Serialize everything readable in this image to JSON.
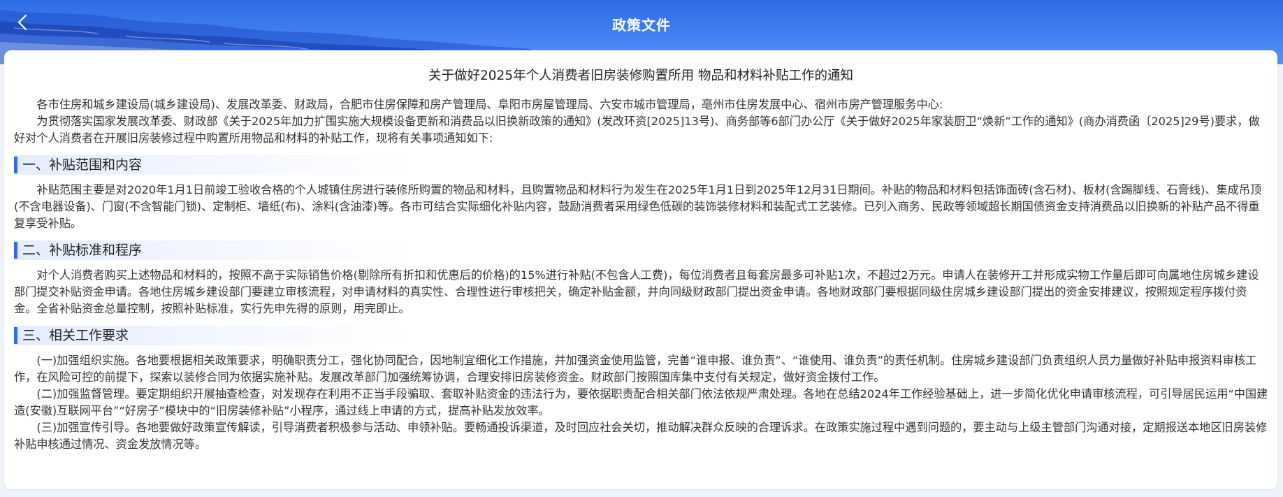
{
  "header": {
    "title": "政策文件",
    "back_icon": "chevron-left-icon",
    "colors": {
      "primary": "#2f6de6",
      "wave": "#1a3fb0"
    }
  },
  "document": {
    "title": "关于做好2025年个人消费者旧房装修购置所用 物品和材料补贴工作的通知",
    "addressee": "各市住房和城乡建设局(城乡建设局)、发展改革委、财政局，合肥市住房保障和房产管理局、阜阳市房屋管理局、六安市城市管理局，亳州市住房发展中心、宿州市房产管理服务中心:",
    "intro": "为贯彻落实国家发展改革委、财政部《关于2025年加力扩围实施大规模设备更新和消费品以旧换新政策的通知》(发改环资[2025]13号)、商务部等6部门办公厅《关于做好2025年家装厨卫“焕新”工作的通知》(商办消费函〔2025]29号)要求，做好对个人消费者在开展旧房装修过程中购置所用物品和材料的补贴工作，现将有关事项通知如下:",
    "sections": [
      {
        "heading": "一、补贴范围和内容",
        "paragraphs": [
          "补贴范围主要是对2020年1月1日前竣工验收合格的个人城镇住房进行装修所购置的物品和材料，且购置物品和材料行为发生在2025年1月1日到2025年12月31日期间。补贴的物品和材料包括饰面砖(含石材)、板材(含踢脚线、石膏线)、集成吊顶(不含电器设备)、门窗(不含智能门锁)、定制柜、墙纸(布)、涂料(含油漆)等。各市可结合实际细化补贴内容，鼓励消费者采用绿色低碳的装饰装修材料和装配式工艺装修。已列入商务、民政等领域超长期国债资金支持消费品以旧换新的补贴产品不得重复享受补贴。"
        ]
      },
      {
        "heading": "二、补贴标准和程序",
        "paragraphs": [
          "对个人消费者购买上述物品和材料的，按照不高于实际销售价格(剔除所有折扣和优惠后的价格)的15%进行补贴(不包含人工费)，每位消费者且每套房最多可补贴1次，不超过2万元。申请人在装修开工并形成实物工作量后即可向属地住房城乡建设部门提交补贴资金申请。各地住房城乡建设部门要建立审核流程，对申请材料的真实性、合理性进行审核把关，确定补贴金额，并向同级财政部门提出资金申请。各地财政部门要根据同级住房城乡建设部门提出的资金安排建议，按照规定程序拨付资金。全省补贴资金总量控制，按照补贴标准，实行先申先得的原则，用完即止。"
        ]
      },
      {
        "heading": "三、相关工作要求",
        "paragraphs": [
          "(一)加强组织实施。各地要根据相关政策要求，明确职责分工，强化协同配合，因地制宜细化工作措施，并加强资金使用监管，完善“谁申报、谁负责”、“谁使用、谁负责”的责任机制。住房城乡建设部门负责组织人员力量做好补贴申报资料审核工作，在风险可控的前提下，探索以装修合同为依据实施补贴。发展改革部门加强统筹协调，合理安排旧房装修资金。财政部门按照国库集中支付有关规定，做好资金拨付工作。",
          "(二)加强监督管理。要定期组织开展抽查检查，对发现存在利用不正当手段骗取、套取补贴资金的违法行为，要依据职责配合相关部门依法依规严肃处理。各地在总结2024年工作经验基础上，进一步简化优化申请审核流程，可引导居民运用“中国建造(安徽)互联网平台”“好房子”模块中的“旧房装修补贴”小程序，通过线上申请的方式，提高补贴发放效率。",
          "(三)加强宣传引导。各地要做好政策宣传解读，引导消费者积极参与活动、申领补贴。要畅通投诉渠道，及时回应社会关切，推动解决群众反映的合理诉求。在政策实施过程中遇到问题的，要主动与上级主管部门沟通对接，定期报送本地区旧房装修补贴申核通过情况、资金发放情况等。"
        ]
      }
    ]
  }
}
